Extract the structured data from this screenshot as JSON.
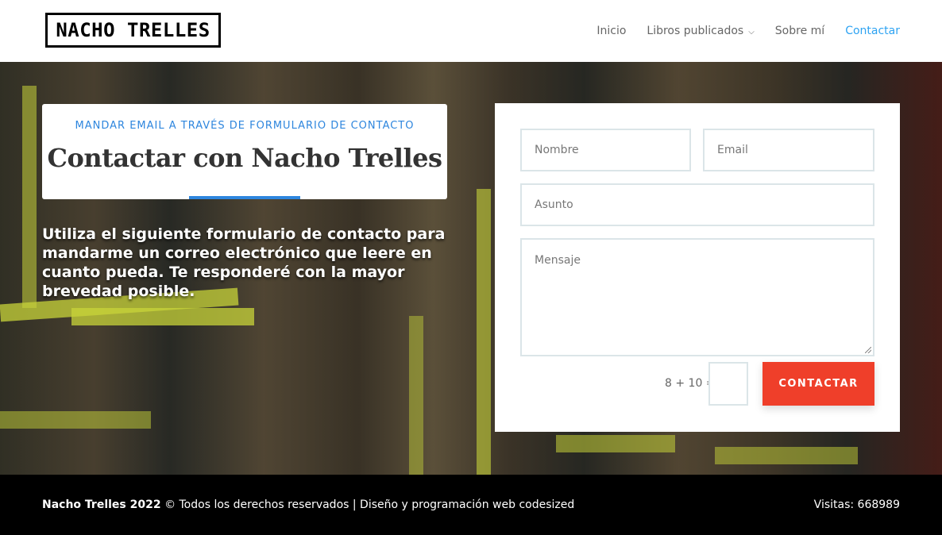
{
  "header": {
    "logo_text": "NACHO TRELLES",
    "nav": [
      {
        "label": "Inicio"
      },
      {
        "label": "Libros publicados",
        "has_dropdown": true
      },
      {
        "label": "Sobre mí"
      },
      {
        "label": "Contactar",
        "active": true
      }
    ]
  },
  "hero": {
    "eyebrow": "MANDAR EMAIL A TRAVÉS DE FORMULARIO DE CONTACTO",
    "title": "Contactar con Nacho Trelles",
    "intro": "Utiliza el siguiente formulario de contacto para mandarme un correo electrónico que leere en cuanto pueda. Te responderé con la mayor brevedad posible."
  },
  "form": {
    "name_placeholder": "Nombre",
    "email_placeholder": "Email",
    "subject_placeholder": "Asunto",
    "message_placeholder": "Mensaje",
    "captcha_question": "8 + 10 =",
    "submit_label": "CONTACTAR"
  },
  "footer": {
    "brand": "Nacho Trelles 2022",
    "rights": "© Todos los derechos reservados | Diseño y programación web codesized",
    "visits": "Visitas: 668989"
  },
  "colors": {
    "accent": "#2ea3f2",
    "eyebrow": "#2e86de",
    "submit": "#ef3f2a",
    "footer_bg": "#000000"
  },
  "icons": {
    "nav_dropdown": "chevron-down-icon",
    "textarea_resize": "resize-handle-icon"
  }
}
